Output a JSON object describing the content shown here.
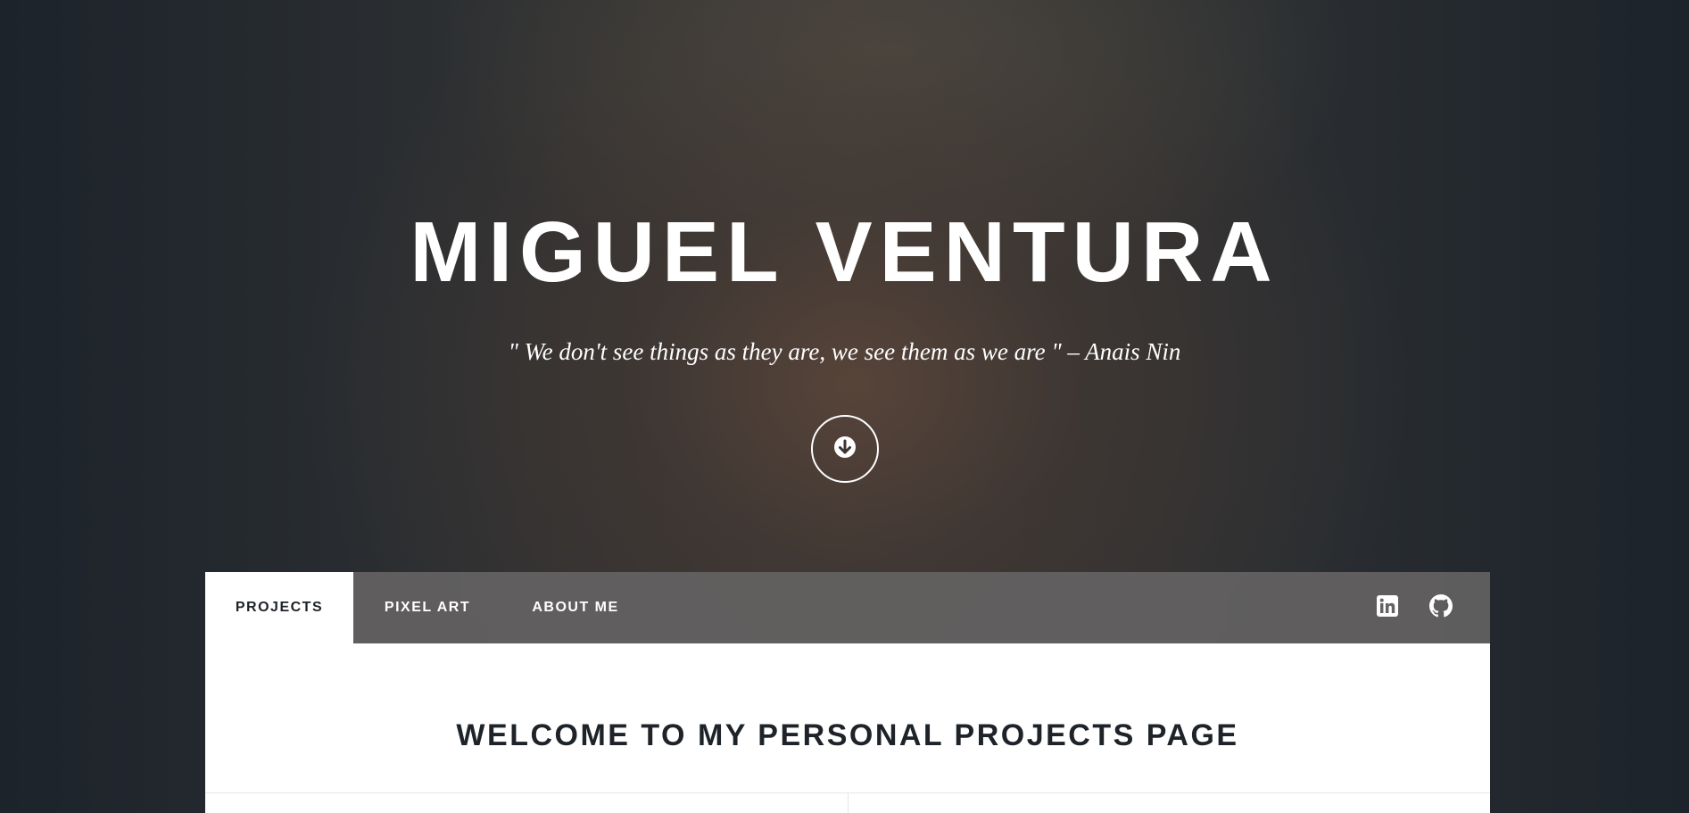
{
  "hero": {
    "title": "MIGUEL VENTURA",
    "quote": "\" We don't see things as they are, we see them as we are \"  – Anais Nin"
  },
  "scroll_button": {
    "icon": "arrow-down-icon"
  },
  "nav": {
    "tabs": [
      {
        "label": "PROJECTS",
        "active": true
      },
      {
        "label": "PIXEL ART",
        "active": false
      },
      {
        "label": "ABOUT ME",
        "active": false
      }
    ],
    "social": [
      {
        "icon": "linkedin-icon"
      },
      {
        "icon": "github-icon"
      }
    ]
  },
  "main": {
    "heading": "WELCOME TO MY PERSONAL PROJECTS PAGE"
  },
  "colors": {
    "text_dark": "#1e2329",
    "nav_bg": "#646262",
    "white": "#ffffff"
  }
}
